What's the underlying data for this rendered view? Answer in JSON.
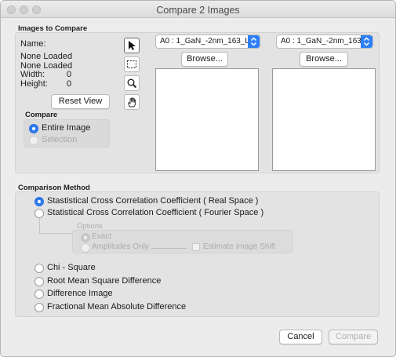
{
  "window": {
    "title": "Compare 2 Images"
  },
  "images_section": {
    "label": "Images to Compare",
    "name_label": "Name:",
    "status_line_1": "None Loaded",
    "status_line_2": "None Loaded",
    "width_label": "Width:",
    "width_value": "0",
    "height_label": "Height:",
    "height_value": "0",
    "reset_view_button": "Reset View",
    "compare_group": {
      "label": "Compare",
      "options": [
        "Entire Image",
        "Selection"
      ],
      "selected": "Entire Image"
    },
    "image_a": {
      "selected": "A0 : 1_GaN_-2nm_163_La",
      "browse_button": "Browse..."
    },
    "image_b": {
      "selected": "A0 : 1_GaN_-2nm_163_",
      "browse_button": "Browse..."
    },
    "tools": [
      "arrow-pointer-icon",
      "marquee-select-icon",
      "zoom-icon",
      "hand-pan-icon"
    ]
  },
  "method_section": {
    "label": "Comparison Method",
    "methods": [
      "Stastistical Cross Correlation Coefficient ( Real Space )",
      "Statistical Cross Correlation Coefficient ( Fourier Space )",
      "Chi - Square",
      "Root Mean Square Difference",
      "Difference Image",
      "Fractional Mean Absolute Difference"
    ],
    "selected": "Stastistical Cross Correlation Coefficient ( Real Space )",
    "options": {
      "label": "Options",
      "radio_exact": "Exact",
      "radio_amplitudes": "Amplitudes Only",
      "checkbox_label": "Estimate Image Shift"
    }
  },
  "footer": {
    "cancel_button": "Cancel",
    "compare_button": "Compare"
  },
  "colors": {
    "accent": "#2c7cf6",
    "window_bg": "#ececec",
    "panel_bg": "#e3e3e3"
  }
}
